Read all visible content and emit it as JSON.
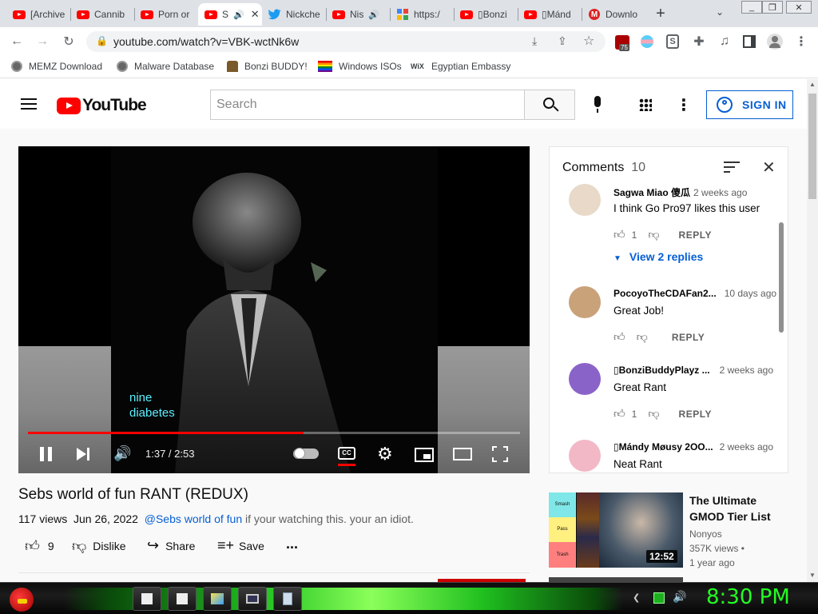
{
  "browser": {
    "tabs": [
      {
        "title": "[Archive",
        "icon": "youtube-icon"
      },
      {
        "title": "Cannib",
        "icon": "youtube-icon"
      },
      {
        "title": "Porn or",
        "icon": "youtube-icon"
      },
      {
        "title": "S",
        "icon": "youtube-icon",
        "active": true,
        "audio": true
      },
      {
        "title": "Nickche",
        "icon": "twitter-icon"
      },
      {
        "title": "Nis",
        "icon": "youtube-icon",
        "audio": true
      },
      {
        "title": "https:/",
        "icon": "google-icon"
      },
      {
        "title": "▯Bonzi",
        "icon": "youtube-icon"
      },
      {
        "title": "▯Mánd",
        "icon": "youtube-icon"
      },
      {
        "title": "Downlo",
        "icon": "mail-icon"
      }
    ],
    "new_tab_symbol": "+",
    "url": "youtube.com/watch?v=VBK-wctNk6w",
    "extension_badge": "75",
    "bookmarks": [
      {
        "label": "MEMZ Download",
        "icon": "globe-icon"
      },
      {
        "label": "Malware Database",
        "icon": "globe-icon"
      },
      {
        "label": "Bonzi BUDDY!",
        "icon": "bonzi-icon"
      },
      {
        "label": "Windows ISOs",
        "icon": "rainbow-flag-icon"
      },
      {
        "label": "Egyptian Embassy",
        "icon": "wix-icon"
      }
    ]
  },
  "youtube": {
    "logo_text": "YouTube",
    "search_placeholder": "Search",
    "sign_in_label": "SIGN IN",
    "player": {
      "caption_line1": "nine",
      "caption_line2": "diabetes",
      "time": "1:37 / 2:53",
      "progress_fraction": 0.56
    },
    "video": {
      "title": "Sebs world of fun RANT (REDUX)",
      "views": "117 views",
      "date": "Jun 26, 2022",
      "mention": "@Sebs world of fun",
      "description": " if your watching this. your an idiot.",
      "likes": "9",
      "dislike_label": "Dislike",
      "share_label": "Share",
      "save_label": "Save",
      "more_label": "..."
    },
    "comments_panel": {
      "title": "Comments",
      "count": "10",
      "items": [
        {
          "author": "Sagwa Miao 傻瓜",
          "age": "2 weeks ago",
          "text": "I think Go Pro97 likes this user",
          "likes": "1",
          "reply": "REPLY",
          "avatar_color": "#e8d9c8"
        },
        {
          "author": "PocoyoTheCDAFan2...",
          "age": "10 days ago",
          "text": "Great Job!",
          "likes": "",
          "reply": "REPLY",
          "avatar_color": "#c9a27a"
        },
        {
          "author": "▯BonziBuddyPlayz ...",
          "age": "2 weeks ago",
          "text": "Great Rant",
          "likes": "1",
          "reply": "REPLY",
          "avatar_color": "#8a63c9"
        },
        {
          "author": "▯Mándy Møusy 2OO...",
          "age": "2 weeks ago",
          "text": "Neat Rant",
          "likes": "",
          "reply": "REPLY",
          "avatar_color": "#f2b8c6"
        }
      ],
      "view_replies": "View 2 replies"
    },
    "recommended": [
      {
        "title": "The Ultimate GMOD Tier List",
        "title_line1": "The Ultimate",
        "title_line2": "GMOD Tier List",
        "channel": "Nonyos",
        "views": "357K views •",
        "age": "1 year ago",
        "duration": "12:52",
        "tiers": [
          "Smash",
          "Pass",
          "Trash"
        ]
      }
    ]
  },
  "taskbar": {
    "clock": "8:30 PM"
  }
}
